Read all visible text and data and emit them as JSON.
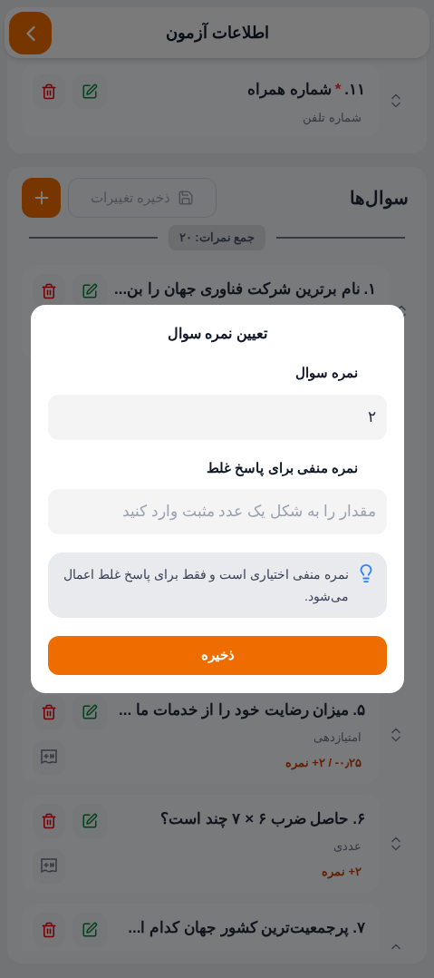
{
  "header": {
    "title": "اطلاعات آزمون"
  },
  "top_items": [
    {
      "number": "۱۱.",
      "required_mark": "*",
      "title": "شماره همراه",
      "type": "شماره تلفن",
      "grade_button": false
    }
  ],
  "questions": {
    "title": "سوال‌ها",
    "save_button": {
      "label": "ذخیره تغییرات",
      "disabled": true
    },
    "total": "جمع نمرات: ۲۰",
    "items": [
      {
        "number": "۱.",
        "title": "نام برترین شرکت فناوری جهان را بن...",
        "grade_button": false
      },
      {
        "number": "۵.",
        "title": "میزان رضایت خود را از خدمات ما ...",
        "type": "امتیازدهی",
        "score": "۰٫۲۵- / ۲+ نمره",
        "grade_button": true
      },
      {
        "number": "۶.",
        "title": "حاصل ضرب ۶ × ۷ چند است؟",
        "type": "عددی",
        "score": "۲+ نمره",
        "grade_button": true
      },
      {
        "number": "۷.",
        "title": "پرجمعیت‌ترین کشور جهان کدام ا...",
        "grade_button": false
      }
    ]
  },
  "dialog": {
    "open": true,
    "title": "تعیین نمره سوال",
    "fields": [
      {
        "label": "نمره سوال",
        "value": "۲"
      },
      {
        "label": "نمره منفی برای پاسخ غلط",
        "placeholder": "مقدار را به شکل یک عدد مثبت وارد کنید"
      }
    ],
    "hint": "نمره منفی اختیاری است و فقط برای پاسخ غلط اعمال می‌شود.",
    "submit": "ذخیره"
  }
}
